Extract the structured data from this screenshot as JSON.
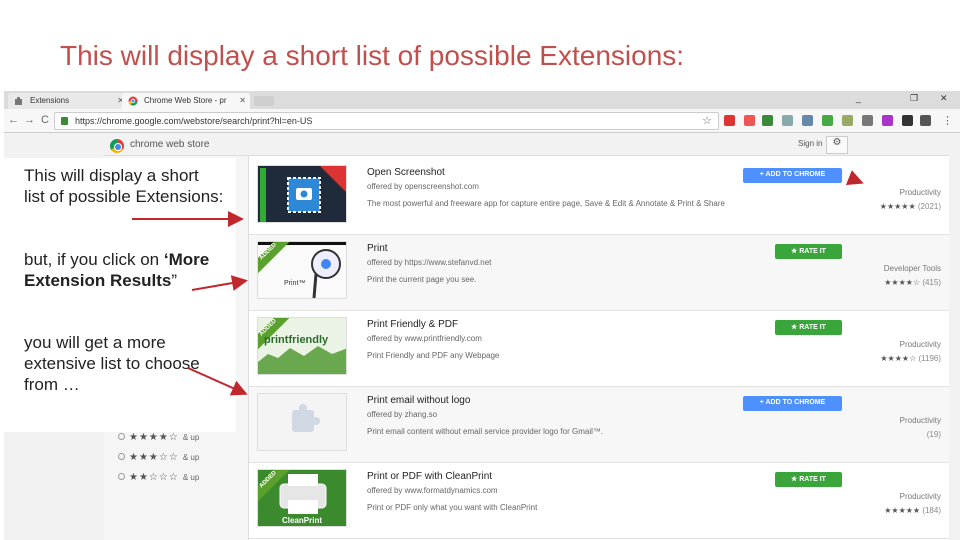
{
  "slide": {
    "title": "This will display a short list of possible Extensions:"
  },
  "browser": {
    "tabs": [
      {
        "label": "Extensions",
        "active": false
      },
      {
        "label": "Chrome Web Store - pr",
        "active": true
      }
    ],
    "url": "https://chrome.google.com/webstore/search/print?hl=en-US",
    "nav": {
      "back": "←",
      "forward": "→",
      "reload": "C"
    },
    "window_controls": {
      "minimize": "_",
      "restore": "❐",
      "close": "✕"
    },
    "menu_icon": "⋮"
  },
  "store": {
    "name": "chrome web store",
    "signin": "Sign in",
    "gear": "⚙"
  },
  "sidebar": {
    "ratings": [
      {
        "stars": "★★★★☆",
        "label": "& up"
      },
      {
        "stars": "★★★☆☆",
        "label": "& up"
      },
      {
        "stars": "★★☆☆☆",
        "label": "& up"
      }
    ]
  },
  "results": [
    {
      "title": "Open Screenshot",
      "offered": "offered by openscreenshot.com",
      "desc": "The most powerful and freeware app for capture entire page, Save & Edit & Annotate & Print & Share",
      "button": "+ ADD TO CHROME",
      "button_type": "add",
      "category": "Productivity",
      "stars": "★★★★★",
      "count": "(2021)",
      "ribbon": "",
      "thumb_label": ""
    },
    {
      "title": "Print",
      "offered": "offered by https://www.stefanvd.net",
      "desc": "Print the current page you see.",
      "button": "★ RATE IT",
      "button_type": "rate",
      "category": "Developer Tools",
      "stars": "★★★★☆",
      "count": "(415)",
      "ribbon": "ADDED",
      "thumb_label": "Print™"
    },
    {
      "title": "Print Friendly & PDF",
      "offered": "offered by www.printfriendly.com",
      "desc": "Print Friendly and PDF any Webpage",
      "button": "★ RATE IT",
      "button_type": "rate",
      "category": "Productivity",
      "stars": "★★★★☆",
      "count": "(1196)",
      "ribbon": "ADDED",
      "thumb_label": "printfriendly"
    },
    {
      "title": "Print email without logo",
      "offered": "offered by zhang.so",
      "desc": "Print email content without email service provider logo for Gmail™.",
      "button": "+ ADD TO CHROME",
      "button_type": "add",
      "category": "Productivity",
      "stars": "",
      "count": "(19)",
      "ribbon": "",
      "thumb_label": ""
    },
    {
      "title": "Print or PDF with CleanPrint",
      "offered": "offered by www.formatdynamics.com",
      "desc": "Print or PDF only what you want with CleanPrint",
      "button": "★ RATE IT",
      "button_type": "rate",
      "category": "Productivity",
      "stars": "★★★★★",
      "count": "(184)",
      "ribbon": "ADDED",
      "thumb_label": "CleanPrint"
    }
  ],
  "annotations": [
    {
      "text": "This will display a short list of possible Extensions:"
    },
    {
      "pre": "but, if you click on ",
      "bold": "‘More Extension Results",
      "post": "”"
    },
    {
      "text": "you will get a more extensive list to choose from …"
    }
  ],
  "colors": {
    "title_red": "#c0504d",
    "arrow_red": "#c0282d",
    "add_blue": "#4d90fe",
    "rate_green": "#3aa53a"
  }
}
